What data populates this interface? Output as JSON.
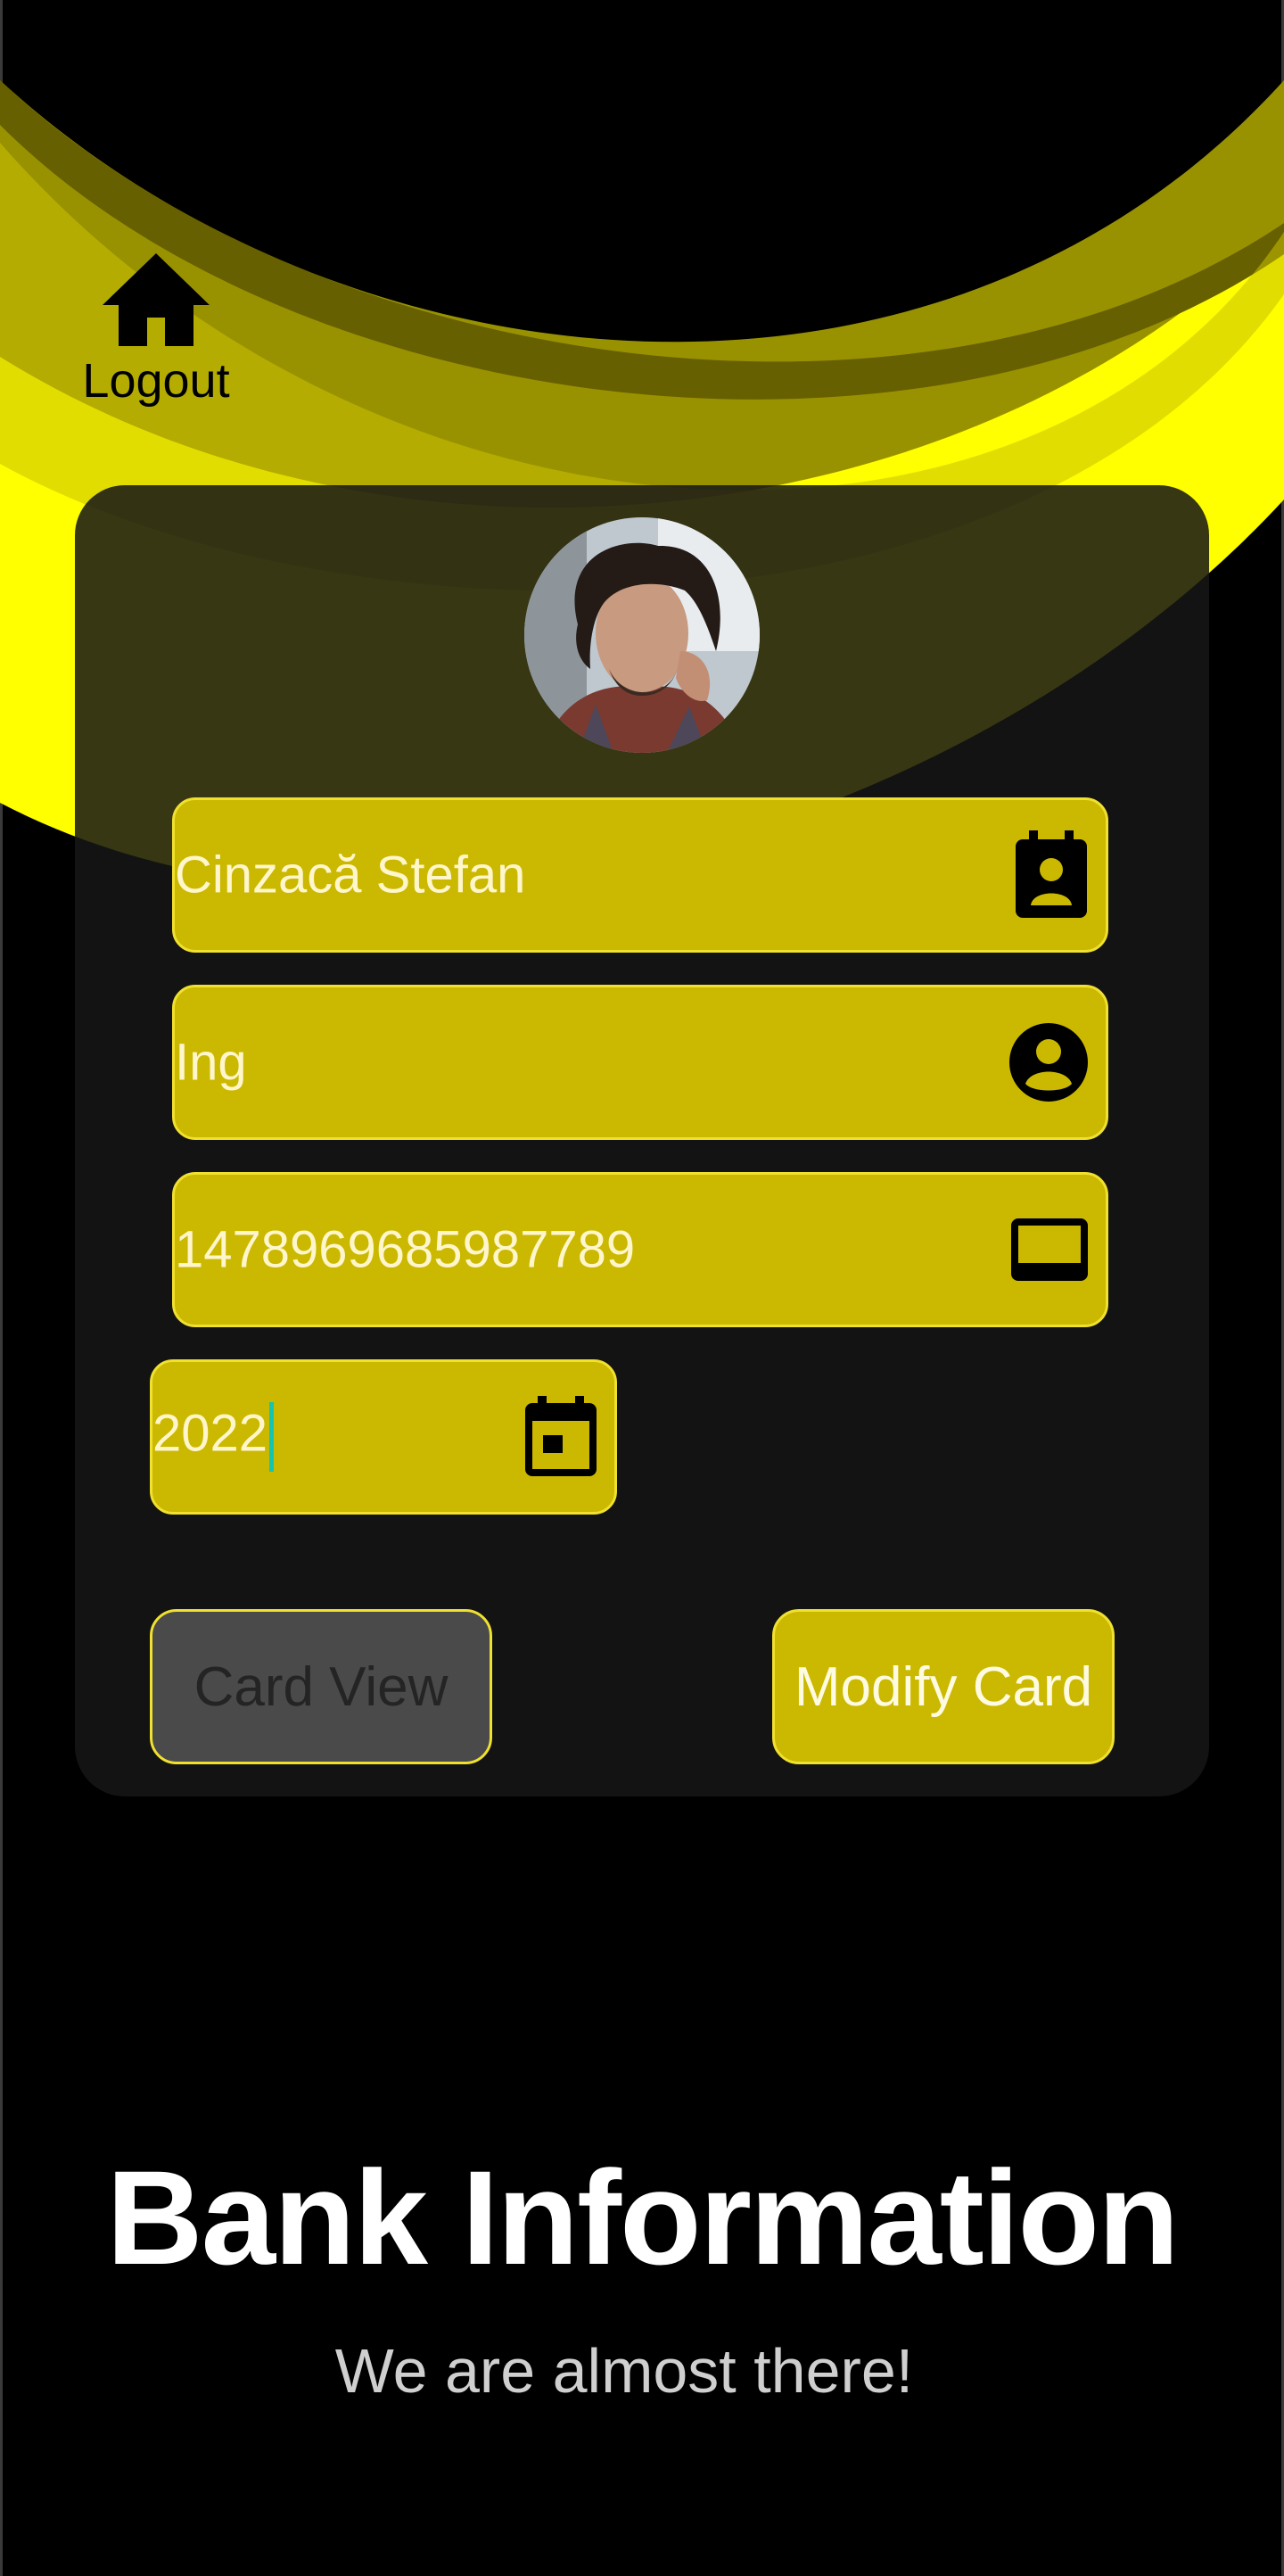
{
  "colors": {
    "accent": "#cbb800",
    "accent_border": "#f0e030",
    "bright_yellow": "#ffff00",
    "background": "#000000",
    "panel": "#161616",
    "button_disabled": "#4a4a4a",
    "caret": "#15c5b0"
  },
  "header": {
    "home_icon": "home-icon",
    "logout_label": "Logout"
  },
  "profile": {
    "avatar": "user-photo"
  },
  "form": {
    "name": {
      "value": "Cinzacă Stefan",
      "icon": "contact-card-icon"
    },
    "bank": {
      "value": "Ing",
      "icon": "account-circle-icon"
    },
    "card_number": {
      "value": "1478969685987789",
      "icon": "credit-card-icon"
    },
    "expiry_year": {
      "value": "2022",
      "icon": "calendar-icon"
    }
  },
  "actions": {
    "card_view_label": "Card View",
    "modify_card_label": "Modify Card"
  },
  "page": {
    "title": "Bank Information",
    "subtitle": "We are almost there!"
  }
}
